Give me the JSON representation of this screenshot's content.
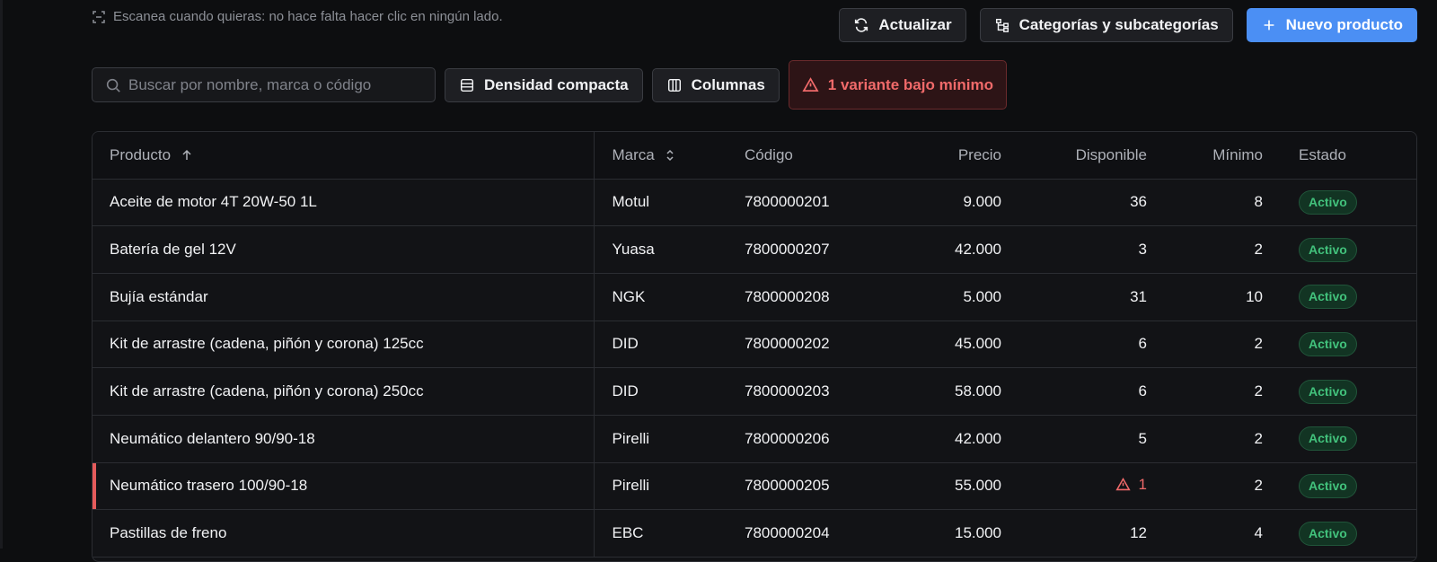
{
  "scan_hint": "Escanea cuando quieras: no hace falta hacer clic en ningún lado.",
  "actions": {
    "refresh": "Actualizar",
    "categories": "Categorías y subcategorías",
    "new_product": "Nuevo producto"
  },
  "toolbar": {
    "search_placeholder": "Buscar por nombre, marca o código",
    "density": "Densidad compacta",
    "columns": "Columnas",
    "alert": "1 variante bajo mínimo"
  },
  "table": {
    "headers": {
      "product": "Producto",
      "brand": "Marca",
      "code": "Código",
      "price": "Precio",
      "available": "Disponible",
      "minimum": "Mínimo",
      "status": "Estado"
    },
    "rows": [
      {
        "product": "Aceite de motor 4T 20W-50 1L",
        "brand": "Motul",
        "code": "7800000201",
        "price": "9.000",
        "available": "36",
        "minimum": "8",
        "status": "Activo"
      },
      {
        "product": "Batería de gel 12V",
        "brand": "Yuasa",
        "code": "7800000207",
        "price": "42.000",
        "available": "3",
        "minimum": "2",
        "status": "Activo"
      },
      {
        "product": "Bujía estándar",
        "brand": "NGK",
        "code": "7800000208",
        "price": "5.000",
        "available": "31",
        "minimum": "10",
        "status": "Activo"
      },
      {
        "product": "Kit de arrastre (cadena, piñón y corona) 125cc",
        "brand": "DID",
        "code": "7800000202",
        "price": "45.000",
        "available": "6",
        "minimum": "2",
        "status": "Activo"
      },
      {
        "product": "Kit de arrastre (cadena, piñón y corona) 250cc",
        "brand": "DID",
        "code": "7800000203",
        "price": "58.000",
        "available": "6",
        "minimum": "2",
        "status": "Activo"
      },
      {
        "product": "Neumático delantero 90/90-18",
        "brand": "Pirelli",
        "code": "7800000206",
        "price": "42.000",
        "available": "5",
        "minimum": "2",
        "status": "Activo"
      },
      {
        "product": "Neumático trasero 100/90-18",
        "brand": "Pirelli",
        "code": "7800000205",
        "price": "55.000",
        "available": "1",
        "minimum": "2",
        "status": "Activo"
      },
      {
        "product": "Pastillas de freno",
        "brand": "EBC",
        "code": "7800000204",
        "price": "15.000",
        "available": "12",
        "minimum": "4",
        "status": "Activo"
      }
    ]
  },
  "colors": {
    "accent": "#4b8ff4",
    "danger": "#f06a6a",
    "success": "#42c27c"
  },
  "icons": {
    "scan": "scan-icon",
    "refresh": "refresh-icon",
    "categories": "category-tree-icon",
    "new_product": "plus-icon",
    "search": "search-icon",
    "density": "density-icon",
    "columns": "columns-icon",
    "warning": "warning-icon",
    "sort_asc": "sort-ascending-icon",
    "sort_both": "sort-both-icon"
  }
}
